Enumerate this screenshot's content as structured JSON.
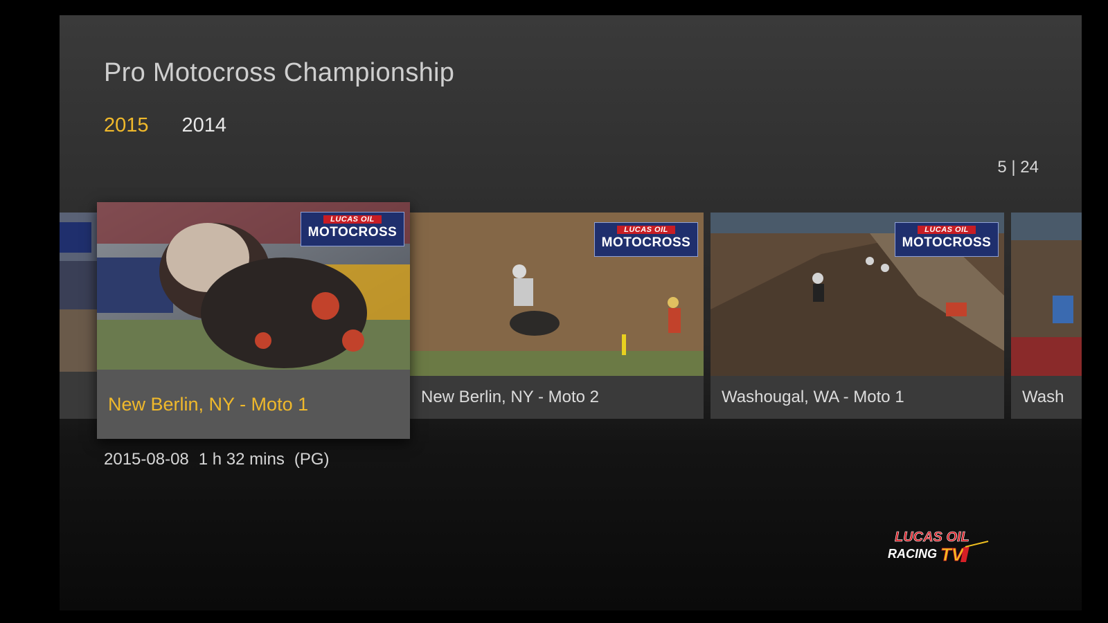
{
  "page": {
    "title": "Pro Motocross Championship"
  },
  "tabs": [
    {
      "label": "2015",
      "active": true
    },
    {
      "label": "2014",
      "active": false
    }
  ],
  "counter": "5 | 24",
  "cards": [
    {
      "caption": "",
      "state": "partial-left"
    },
    {
      "caption": "New Berlin, NY - Moto 1",
      "state": "focused"
    },
    {
      "caption": "New Berlin, NY - Moto 2",
      "state": "normal"
    },
    {
      "caption": "Washougal, WA - Moto 1",
      "state": "normal"
    },
    {
      "caption": "Wash",
      "state": "partial-right"
    }
  ],
  "badge": {
    "line1": "LUCAS OIL",
    "line2": "MOTOCROSS"
  },
  "details": {
    "date": "2015-08-08",
    "duration": "1 h 32 mins",
    "rating": "(PG)"
  },
  "logo": {
    "line1": "LUCAS OIL",
    "line2": "RACING",
    "line3": "TV"
  },
  "colors": {
    "accent": "#f0b92b",
    "badge_blue": "#1f2f6d",
    "brand_red": "#c81d24"
  }
}
